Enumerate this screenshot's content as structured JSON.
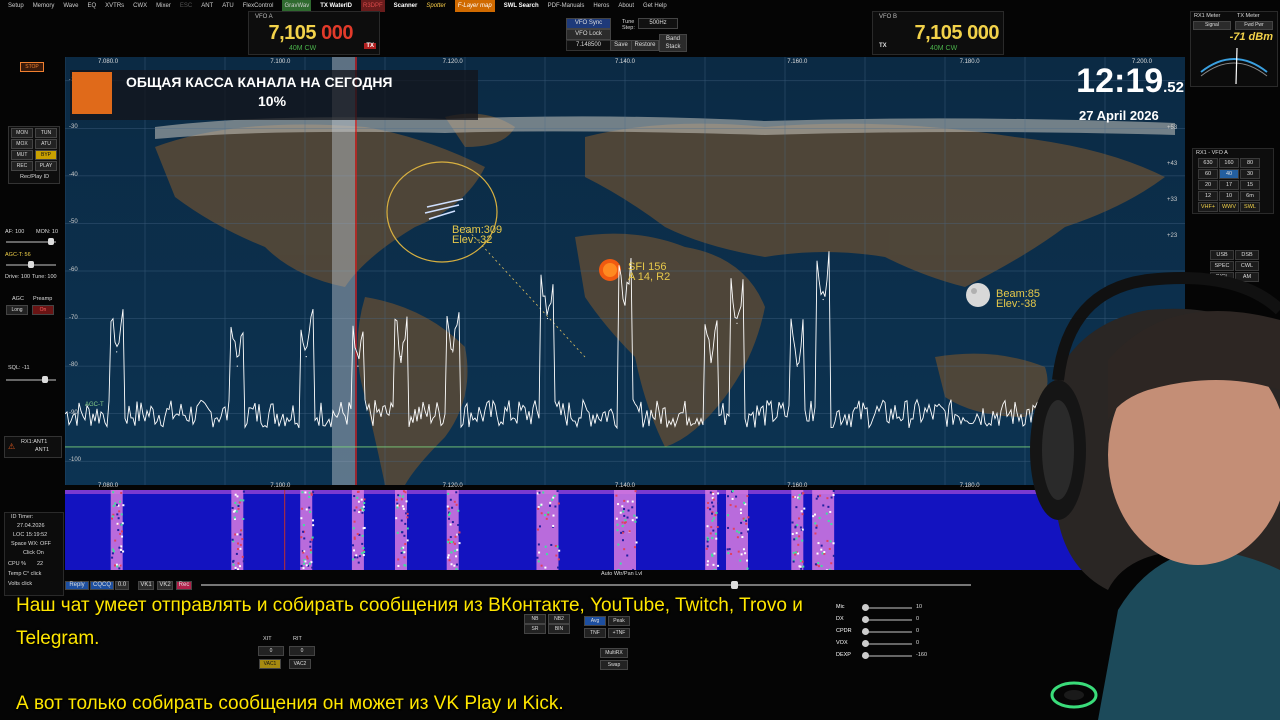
{
  "menu": [
    "Setup",
    "Memory",
    "Wave",
    "EQ",
    "XVTRs",
    "CWX",
    "Mixer",
    "ESC",
    "ANT",
    "ATU",
    "FlexControl",
    "GravWav",
    "TX WaterID",
    "R3DPF",
    "Scanner",
    "Spotter",
    "F-Layer map",
    "SWL Search",
    "PDF-Manuals",
    "Heros",
    "About",
    "Get Help"
  ],
  "vfo_a": {
    "label": "VFO A",
    "freq_main": "7,105",
    "freq_tail": "000",
    "mode": "40M CW",
    "tx": "TX"
  },
  "vfo_b": {
    "label": "VFO B",
    "freq_main": "7,105",
    "freq_tail": "000",
    "mode": "40M CW",
    "tx": "TX"
  },
  "vfo_controls": {
    "sync": "VFO Sync",
    "lock": "VFO Lock",
    "freq": "7.148500",
    "tune_step_label": "Tune Step:",
    "tune_step": "500Hz",
    "save": "Save",
    "restore": "Restore",
    "band_stack": "Band Stack"
  },
  "meters": {
    "rx1_meter": "RX1 Meter",
    "tx_meter": "TX Meter",
    "rx_mode": "Signal",
    "tx_mode": "Fwd Pwr",
    "dbm": "-71 dBm"
  },
  "spectrum": {
    "freq_ticks": [
      "7.080.0",
      "7.100.0",
      "7.120.0",
      "7.140.0",
      "7.160.0",
      "7.180.0",
      "7.200.0"
    ],
    "db_ticks": [
      "-20",
      "-30",
      "-40",
      "-50",
      "-60",
      "-70",
      "-80",
      "-90",
      "-100"
    ],
    "db_right": [
      "+53",
      "+43",
      "+33",
      "+23"
    ],
    "agc_label": "AGC-T",
    "beam1": {
      "line1": "Beam:309",
      "line2": "Elev:-32"
    },
    "beam2": {
      "line1": "Beam:85",
      "line2": "Elev:-38"
    },
    "sun": {
      "line1": "SFI 156",
      "line2": "A 14, R2"
    }
  },
  "overlay": {
    "donation_title": "ОБЩАЯ КАССА КАНАЛА НА СЕГОДНЯ",
    "donation_pct": "10%"
  },
  "clock": {
    "time": "12:19",
    "seconds": ".52",
    "date": "27 April 2026"
  },
  "left_panel": {
    "stop": "STOP",
    "buttons": [
      "MON",
      "TUN",
      "MOX",
      "ATU",
      "MUT",
      "BYP",
      "REC",
      "PLAY"
    ],
    "recplay": "Rec/Play ID",
    "af": "AF: 100",
    "mon": "MON: 10",
    "agc_gain": "AGC-T: 56",
    "drive": "Drive: 100",
    "tune_pwr": "Tune: 100",
    "agc": "AGC",
    "preamp": "Preamp",
    "agc_val": "Long",
    "preamp_val": "On",
    "sql": "SQL: -11",
    "ant": "RX1:ANT1",
    "ant2": "ANT1",
    "id_timer": "ID Timer:",
    "date_small": "27.04.2026",
    "loc": "LOC 15:19:52",
    "space_wx": "Space WX: OFF",
    "click_on": "Click On",
    "cpu": "CPU %",
    "cpu_val": "22",
    "temp": "Temp C° click",
    "volts": "Volts click"
  },
  "bottom_bar": {
    "auto_label": "Auto Wtr/Pan Lvl",
    "reply": "Reply",
    "cqcq": "CQCQ",
    "val": "0.0",
    "vk1": "VK1",
    "vk2": "VK2",
    "rec": "Rec"
  },
  "bottom_controls": {
    "vac1": "VAC1",
    "vac2": "VAC2",
    "xit": "XIT",
    "rit": "RIT",
    "zero": "0",
    "avg": "Avg",
    "peak": "Peak",
    "nb": "NB",
    "nb2": "NB2",
    "sr": "SR",
    "bin": "BIN",
    "tnf": "TNF",
    "plus_tnf": "+TNF",
    "multirx": "MultiRX",
    "swap": "Swap"
  },
  "right_controls": {
    "mic": "Mic",
    "dx": "DX",
    "cpdr": "CPDR",
    "vox": "VOX",
    "dexp": "DEXP",
    "mic_val": "10",
    "dx_val": "0",
    "cpdr_val": "0",
    "vox_val": "0",
    "dexp_val": "-160",
    "transmit_profile": "Transmit Pro",
    "tx_filter": "TX Filt",
    "rx_label": "RX"
  },
  "vfo_grid": {
    "title": "RX1 - VFO A",
    "rows": [
      [
        "630",
        "160",
        "80"
      ],
      [
        "60",
        "40",
        "30"
      ],
      [
        "20",
        "17",
        "15"
      ],
      [
        "12",
        "10",
        "6m"
      ],
      [
        "VHF+",
        "WWV",
        "SWL"
      ]
    ]
  },
  "mode_grid": [
    "USB",
    "DSB",
    "SPEC",
    "CWL",
    "DIGL",
    "AM"
  ],
  "subtitles": {
    "line1": "Наш чат умеет отправлять и собирать сообщения из ВКонтакте, YouTube, Twitch, Trovo и",
    "line2": "Telegram.",
    "line3": "А вот только собирать сообщения он может из VK Play и Kick."
  },
  "colors": {
    "vfo_freq": "#f2d24a",
    "subtitle": "#ffe600",
    "spectrum_line": "#ffffff",
    "tuning_marker": "#e02020",
    "waterfall_bg": "#1313c0",
    "waterfall_signal": "#d77be0"
  },
  "chart_data": {
    "type": "line",
    "x_unit": "MHz",
    "xlim": [
      7.075,
      7.205
    ],
    "ylim": [
      -105,
      -15
    ],
    "peaks": [
      {
        "x": 7.081,
        "y": -77
      },
      {
        "x": 7.095,
        "y": -80
      },
      {
        "x": 7.103,
        "y": -78
      },
      {
        "x": 7.109,
        "y": -80
      },
      {
        "x": 7.114,
        "y": -78
      },
      {
        "x": 7.12,
        "y": -77
      },
      {
        "x": 7.131,
        "y": -70
      },
      {
        "x": 7.14,
        "y": -67
      },
      {
        "x": 7.15,
        "y": -79
      },
      {
        "x": 7.153,
        "y": -71
      },
      {
        "x": 7.16,
        "y": -80
      },
      {
        "x": 7.163,
        "y": -66
      }
    ],
    "noise_floor": -90,
    "agc_threshold": -97
  }
}
